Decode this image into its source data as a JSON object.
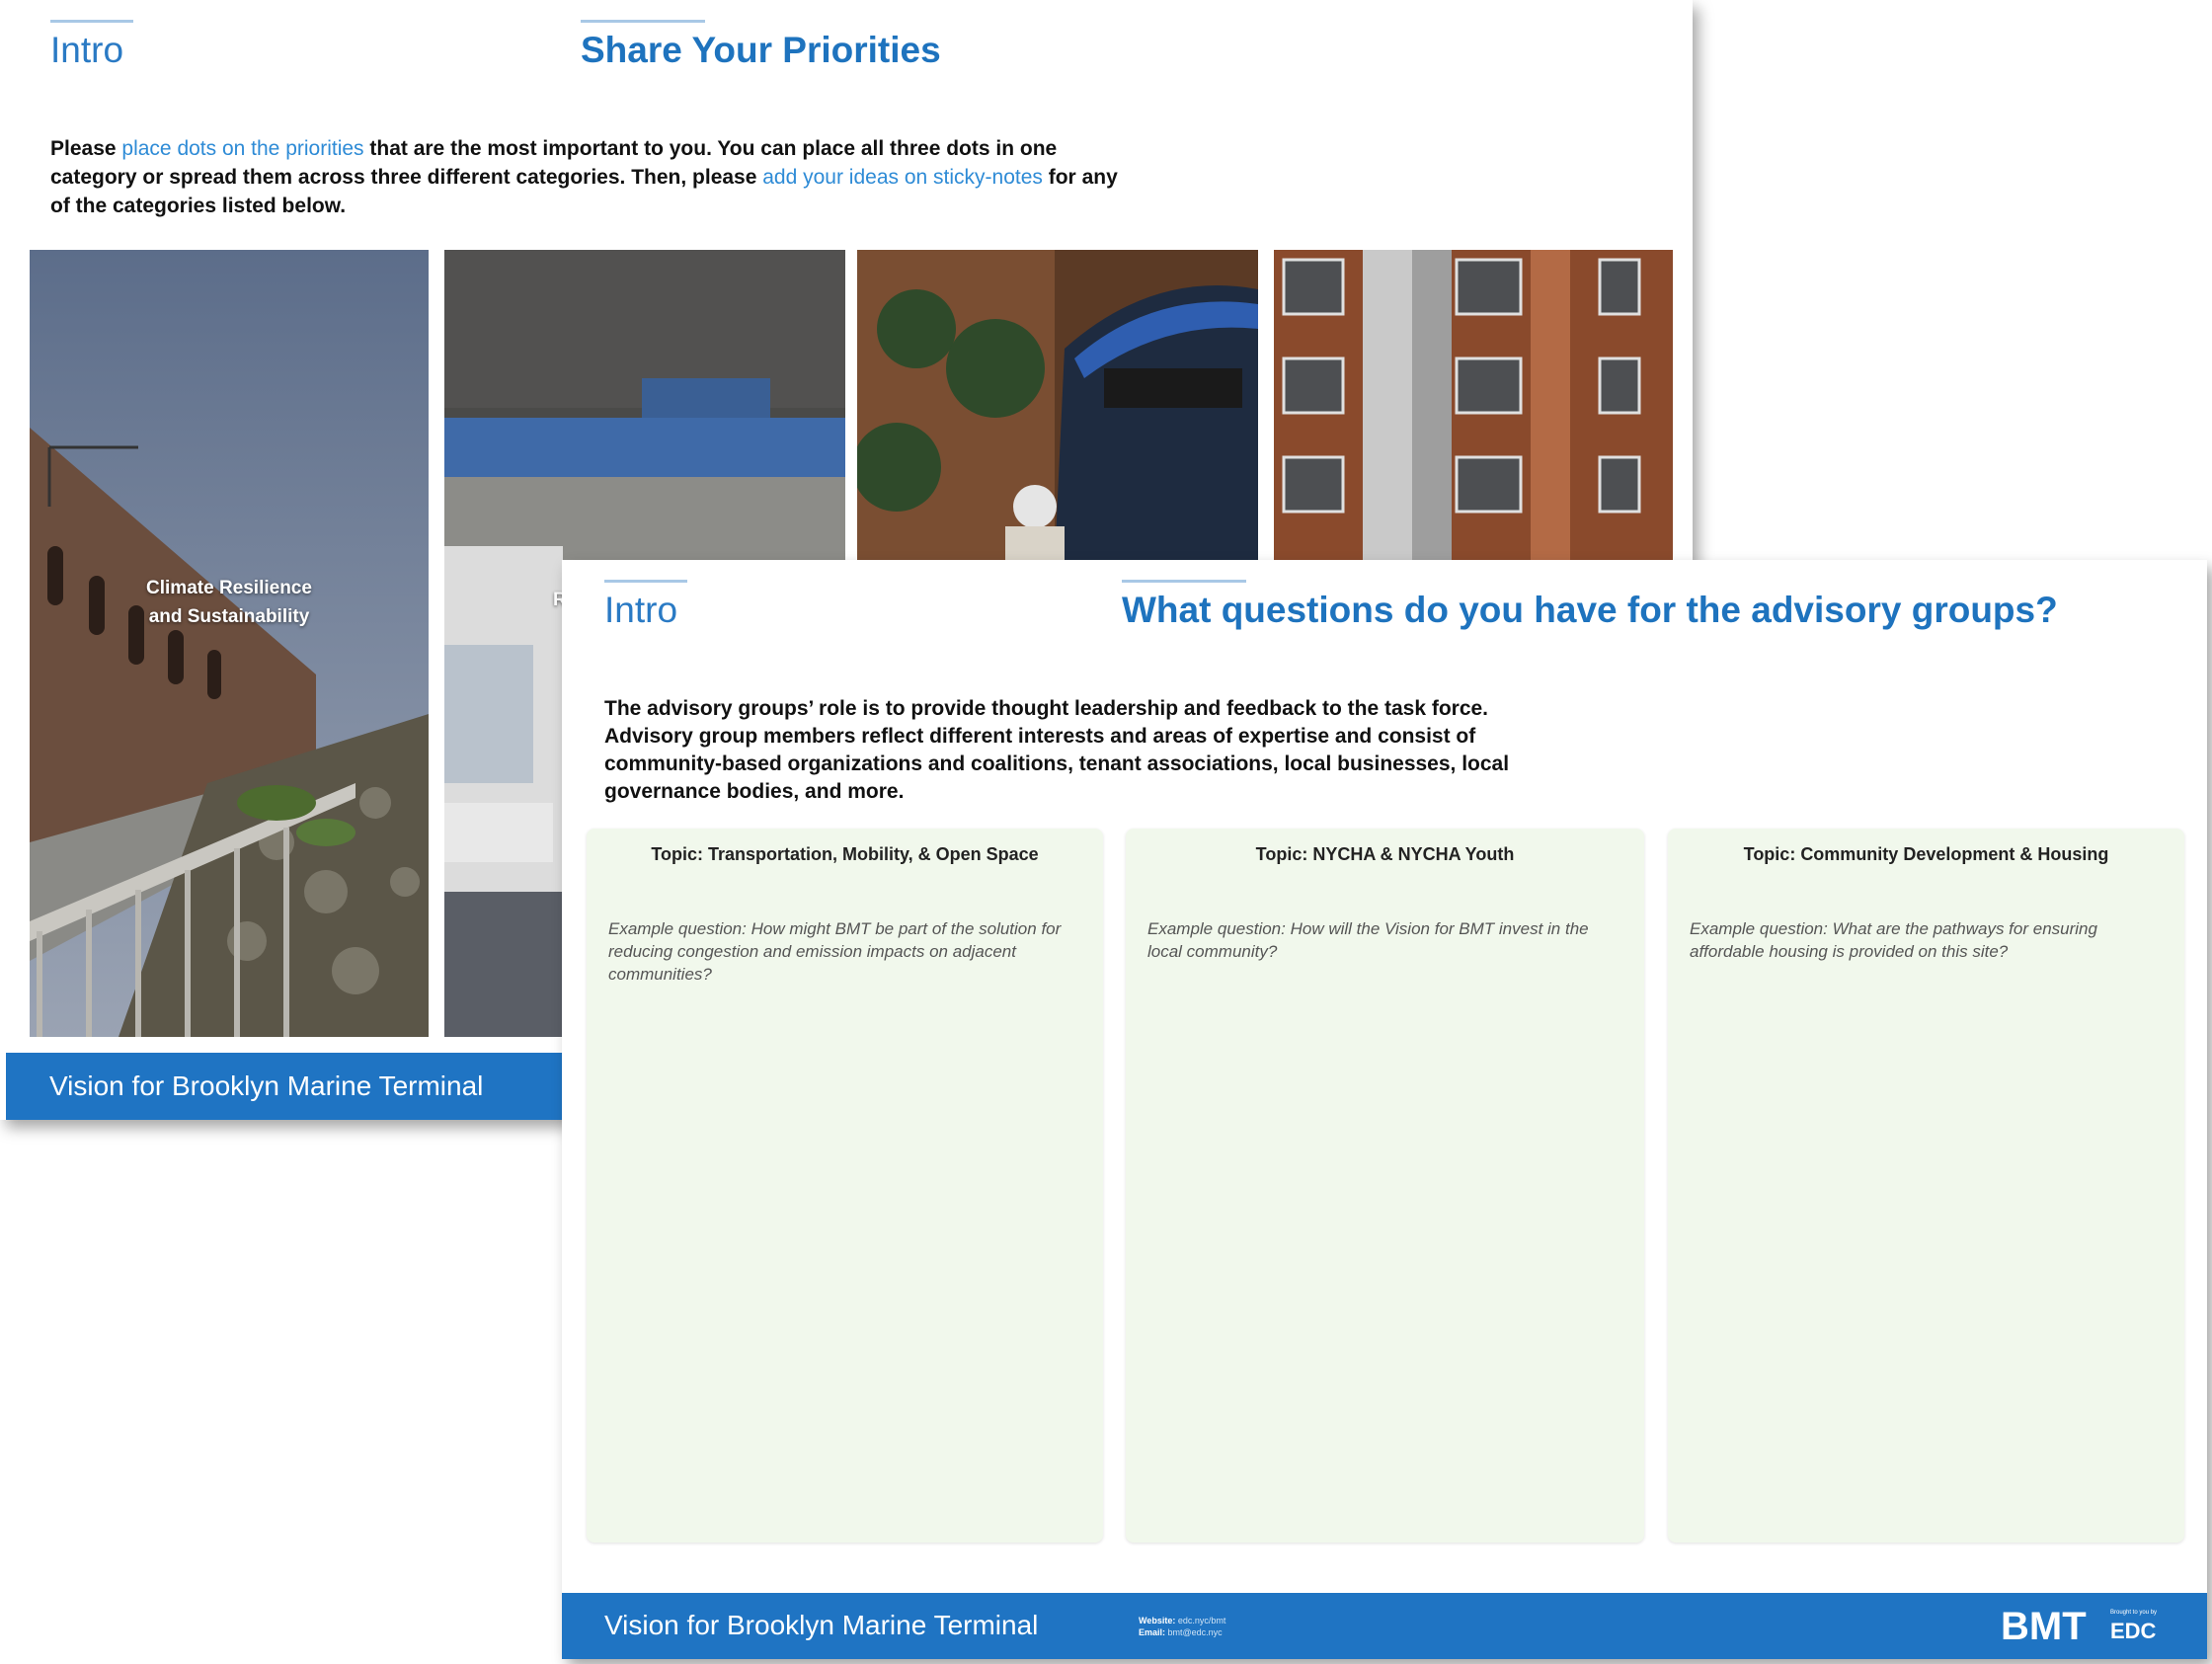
{
  "back_slide": {
    "section": "Intro",
    "title": "Share Your Priorities",
    "instructions": {
      "t1": "Please ",
      "link1": "place dots on the priorities",
      "t2": " that are the most important to you. You can place all three dots in one category or spread them across three different categories. Then, please ",
      "link2": "add your ideas on sticky-notes",
      "t3": " for any of the categories listed below."
    },
    "photos": [
      {
        "label_line1": "Climate Resilience",
        "label_line2": "and Sustainability"
      },
      {
        "label_partial": "R"
      }
    ],
    "footer": "Vision for Brooklyn Marine Terminal"
  },
  "front_slide": {
    "section": "Intro",
    "title": "What questions do you have for the advisory groups?",
    "description": "The advisory groups’ role is to provide thought leadership and feedback to the task force. Advisory group members reflect different interests and areas of expertise and consist of community-based organizations and coalitions, tenant associations, local businesses, local governance bodies, and more.",
    "topics": [
      {
        "title": "Topic: Transportation, Mobility, & Open Space",
        "example": "Example question: How might BMT be part of the solution for reducing congestion and emission impacts on adjacent communities?"
      },
      {
        "title": "Topic: NYCHA & NYCHA Youth",
        "example": "Example question: How will the Vision for BMT invest in the local community?"
      },
      {
        "title": "Topic: Community Development & Housing",
        "example": "Example question: What are the pathways for ensuring affordable housing is provided on this site?"
      }
    ],
    "footer": "Vision for Brooklyn Marine Terminal",
    "contact": {
      "website_label": "Website:",
      "website_value": "edc.nyc/bmt",
      "email_label": "Email:",
      "email_value": "bmt@edc.nyc"
    },
    "logo": {
      "main": "BMT",
      "sub_top": "Brought to you by",
      "sub_main": "EDC"
    }
  }
}
